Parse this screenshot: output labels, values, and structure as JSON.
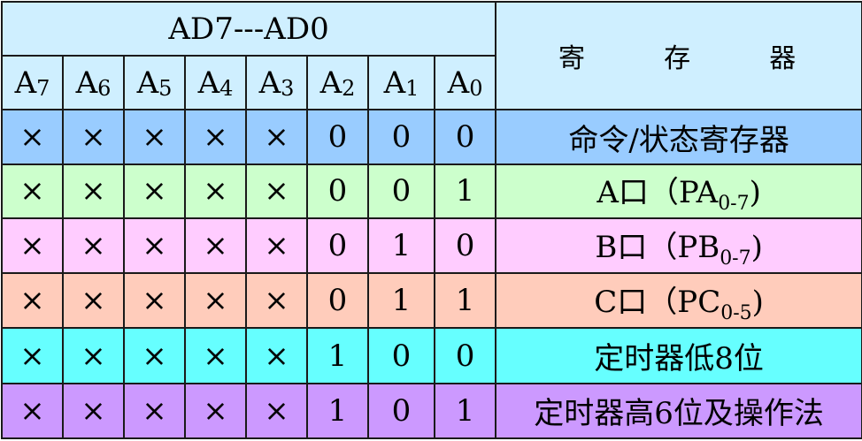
{
  "header": {
    "group_label": "AD7---AD0",
    "register_label_parts": [
      "寄",
      "存",
      "器"
    ],
    "bits": [
      {
        "letter": "A",
        "index": "7"
      },
      {
        "letter": "A",
        "index": "6"
      },
      {
        "letter": "A",
        "index": "5"
      },
      {
        "letter": "A",
        "index": "4"
      },
      {
        "letter": "A",
        "index": "3"
      },
      {
        "letter": "A",
        "index": "2"
      },
      {
        "letter": "A",
        "index": "1"
      },
      {
        "letter": "A",
        "index": "0"
      }
    ]
  },
  "rows": [
    {
      "bits": [
        "×",
        "×",
        "×",
        "×",
        "×",
        "0",
        "0",
        "0"
      ],
      "register": {
        "main": "命令/状态寄存器",
        "sub": "",
        "tail": ""
      },
      "color": "#99ccff"
    },
    {
      "bits": [
        "×",
        "×",
        "×",
        "×",
        "×",
        "0",
        "0",
        "1"
      ],
      "register": {
        "main": "A口（PA",
        "sub": "0-7",
        "tail": ")"
      },
      "color": "#ccffcc"
    },
    {
      "bits": [
        "×",
        "×",
        "×",
        "×",
        "×",
        "0",
        "1",
        "0"
      ],
      "register": {
        "main": "B口（PB",
        "sub": "0-7",
        "tail": ")"
      },
      "color": "#ffccff"
    },
    {
      "bits": [
        "×",
        "×",
        "×",
        "×",
        "×",
        "0",
        "1",
        "1"
      ],
      "register": {
        "main": "C口（PC",
        "sub": "0-5",
        "tail": ")"
      },
      "color": "#ffccbb"
    },
    {
      "bits": [
        "×",
        "×",
        "×",
        "×",
        "×",
        "1",
        "0",
        "0"
      ],
      "register": {
        "main": "定时器低8位",
        "sub": "",
        "tail": ""
      },
      "color": "#66ffff"
    },
    {
      "bits": [
        "×",
        "×",
        "×",
        "×",
        "×",
        "1",
        "0",
        "1"
      ],
      "register": {
        "main": "定时器高6位及操作法",
        "sub": "",
        "tail": ""
      },
      "color": "#cc99ff"
    }
  ],
  "colors": {
    "header_bg": "#cfefff",
    "border": "#1a1a1a"
  }
}
